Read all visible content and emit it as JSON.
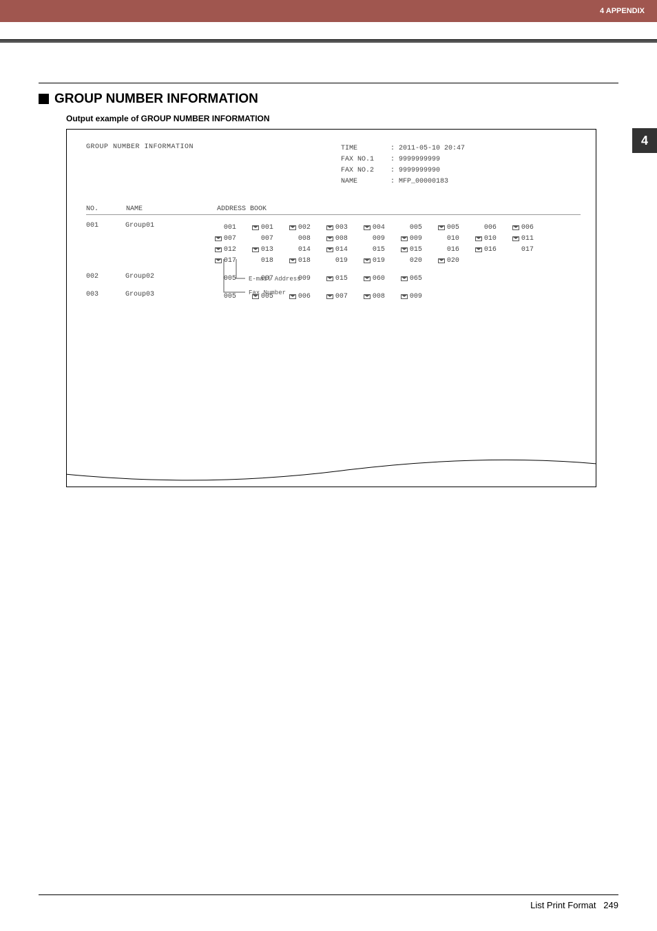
{
  "header_tab": "4 APPENDIX",
  "side_tab": "4",
  "section": {
    "title": "GROUP NUMBER INFORMATION",
    "subtitle": "Output example of GROUP NUMBER INFORMATION"
  },
  "printout": {
    "title": "GROUP NUMBER INFORMATION",
    "meta": [
      {
        "label": "TIME",
        "value": ": 2011-05-10 20:47"
      },
      {
        "label": "FAX NO.1",
        "value": ": 9999999999"
      },
      {
        "label": "FAX NO.2",
        "value": ": 9999999990"
      },
      {
        "label": "NAME",
        "value": ": MFP_00000183"
      }
    ],
    "columns": {
      "no": "NO.",
      "name": "NAME",
      "address_book": "ADDRESS BOOK"
    },
    "callouts": {
      "email": "E-mail Address",
      "fax": "Fax Number"
    },
    "groups": [
      {
        "no": "001",
        "name": "Group01",
        "addresses": [
          {
            "num": "001",
            "email": false
          },
          {
            "num": "001",
            "email": true
          },
          {
            "num": "002",
            "email": true
          },
          {
            "num": "003",
            "email": true
          },
          {
            "num": "004",
            "email": true
          },
          {
            "num": "005",
            "email": false
          },
          {
            "num": "005",
            "email": true
          },
          {
            "num": "006",
            "email": false
          },
          {
            "num": "006",
            "email": true
          },
          {
            "num": "007",
            "email": true
          },
          {
            "num": "007",
            "email": false
          },
          {
            "num": "008",
            "email": false
          },
          {
            "num": "008",
            "email": true
          },
          {
            "num": "009",
            "email": false
          },
          {
            "num": "009",
            "email": true
          },
          {
            "num": "010",
            "email": false
          },
          {
            "num": "010",
            "email": true
          },
          {
            "num": "011",
            "email": true
          },
          {
            "num": "012",
            "email": true
          },
          {
            "num": "013",
            "email": true
          },
          {
            "num": "014",
            "email": false
          },
          {
            "num": "014",
            "email": true
          },
          {
            "num": "015",
            "email": false
          },
          {
            "num": "015",
            "email": true
          },
          {
            "num": "016",
            "email": false
          },
          {
            "num": "016",
            "email": true
          },
          {
            "num": "017",
            "email": false
          },
          {
            "num": "017",
            "email": true
          },
          {
            "num": "018",
            "email": false
          },
          {
            "num": "018",
            "email": true
          },
          {
            "num": "019",
            "email": false
          },
          {
            "num": "019",
            "email": true
          },
          {
            "num": "020",
            "email": false
          },
          {
            "num": "020",
            "email": true
          }
        ]
      },
      {
        "no": "002",
        "name": "Group02",
        "addresses": [
          {
            "num": "005",
            "email": false
          },
          {
            "num": "007",
            "email": false
          },
          {
            "num": "009",
            "email": false
          },
          {
            "num": "015",
            "email": true
          },
          {
            "num": "060",
            "email": true
          },
          {
            "num": "065",
            "email": true
          }
        ]
      },
      {
        "no": "003",
        "name": "Group03",
        "addresses": [
          {
            "num": "005",
            "email": false
          },
          {
            "num": "005",
            "email": true
          },
          {
            "num": "006",
            "email": true
          },
          {
            "num": "007",
            "email": true
          },
          {
            "num": "008",
            "email": true
          },
          {
            "num": "009",
            "email": true
          }
        ]
      }
    ]
  },
  "footer": {
    "section_name": "List Print Format",
    "page": "249"
  }
}
